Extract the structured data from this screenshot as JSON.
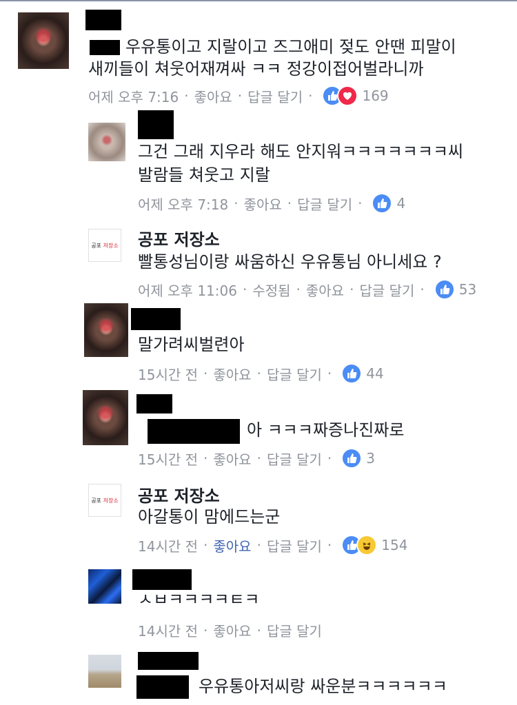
{
  "colors": {
    "meta": "#90949c",
    "link": "#4267b2",
    "like": "#4b8cf5",
    "love": "#f0284a",
    "haha": "#f7c934"
  },
  "comments": [
    {
      "author": "",
      "line1": "우유통이고 지랄이고 즈그애미 젖도 안땐 피말이",
      "line2": "새끼들이 쳐웃어재껴싸 ㅋㅋ 정강이접어벌라니까",
      "time": "어제 오후 7:16",
      "like": "좋아요",
      "reply": "답글 달기",
      "count": "169",
      "reactions": [
        "like",
        "love"
      ]
    },
    {
      "author": "",
      "line1": "그건 그래 지우라 해도 안지워ㅋㅋㅋㅋㅋㅋㅋ씨",
      "line2": "발람들 쳐웃고 지랄",
      "time": "어제 오후 7:18",
      "like": "좋아요",
      "reply": "답글 달기",
      "count": "4",
      "reactions": [
        "like"
      ]
    },
    {
      "author": "공포 저장소",
      "line1": "빨통성님이랑 싸움하신 우유통님 아니세요 ?",
      "time": "어제 오후 11:06",
      "edited": "수정됨",
      "like": "좋아요",
      "reply": "답글 달기",
      "count": "53",
      "reactions": [
        "like"
      ]
    },
    {
      "author": "",
      "line1": "말가려씨벌련아",
      "time": "15시간 전",
      "like": "좋아요",
      "reply": "답글 달기",
      "count": "44",
      "reactions": [
        "like"
      ]
    },
    {
      "author": "",
      "line1": "아 ㅋㅋㅋ짜증나진짜로",
      "time": "15시간 전",
      "like": "좋아요",
      "reply": "답글 달기",
      "count": "3",
      "reactions": [
        "like"
      ]
    },
    {
      "author": "공포 저장소",
      "line1": "아갈통이 맘에드는군",
      "time": "14시간 전",
      "like": "좋아요",
      "reply": "답글 달기",
      "count": "154",
      "reactions": [
        "like",
        "haha"
      ]
    },
    {
      "author": "",
      "line1": "ㅅㅂㅋㅋㅋㅋㅌㅋ",
      "time": "14시간 전",
      "like": "좋아요",
      "reply": "답글 달기"
    },
    {
      "author": "",
      "line1": "우유통아저씨랑 싸운분ㅋㅋㅋㅋㅋㅋ"
    }
  ],
  "brand_avatar": {
    "left": "공포",
    "right": "저장소"
  }
}
